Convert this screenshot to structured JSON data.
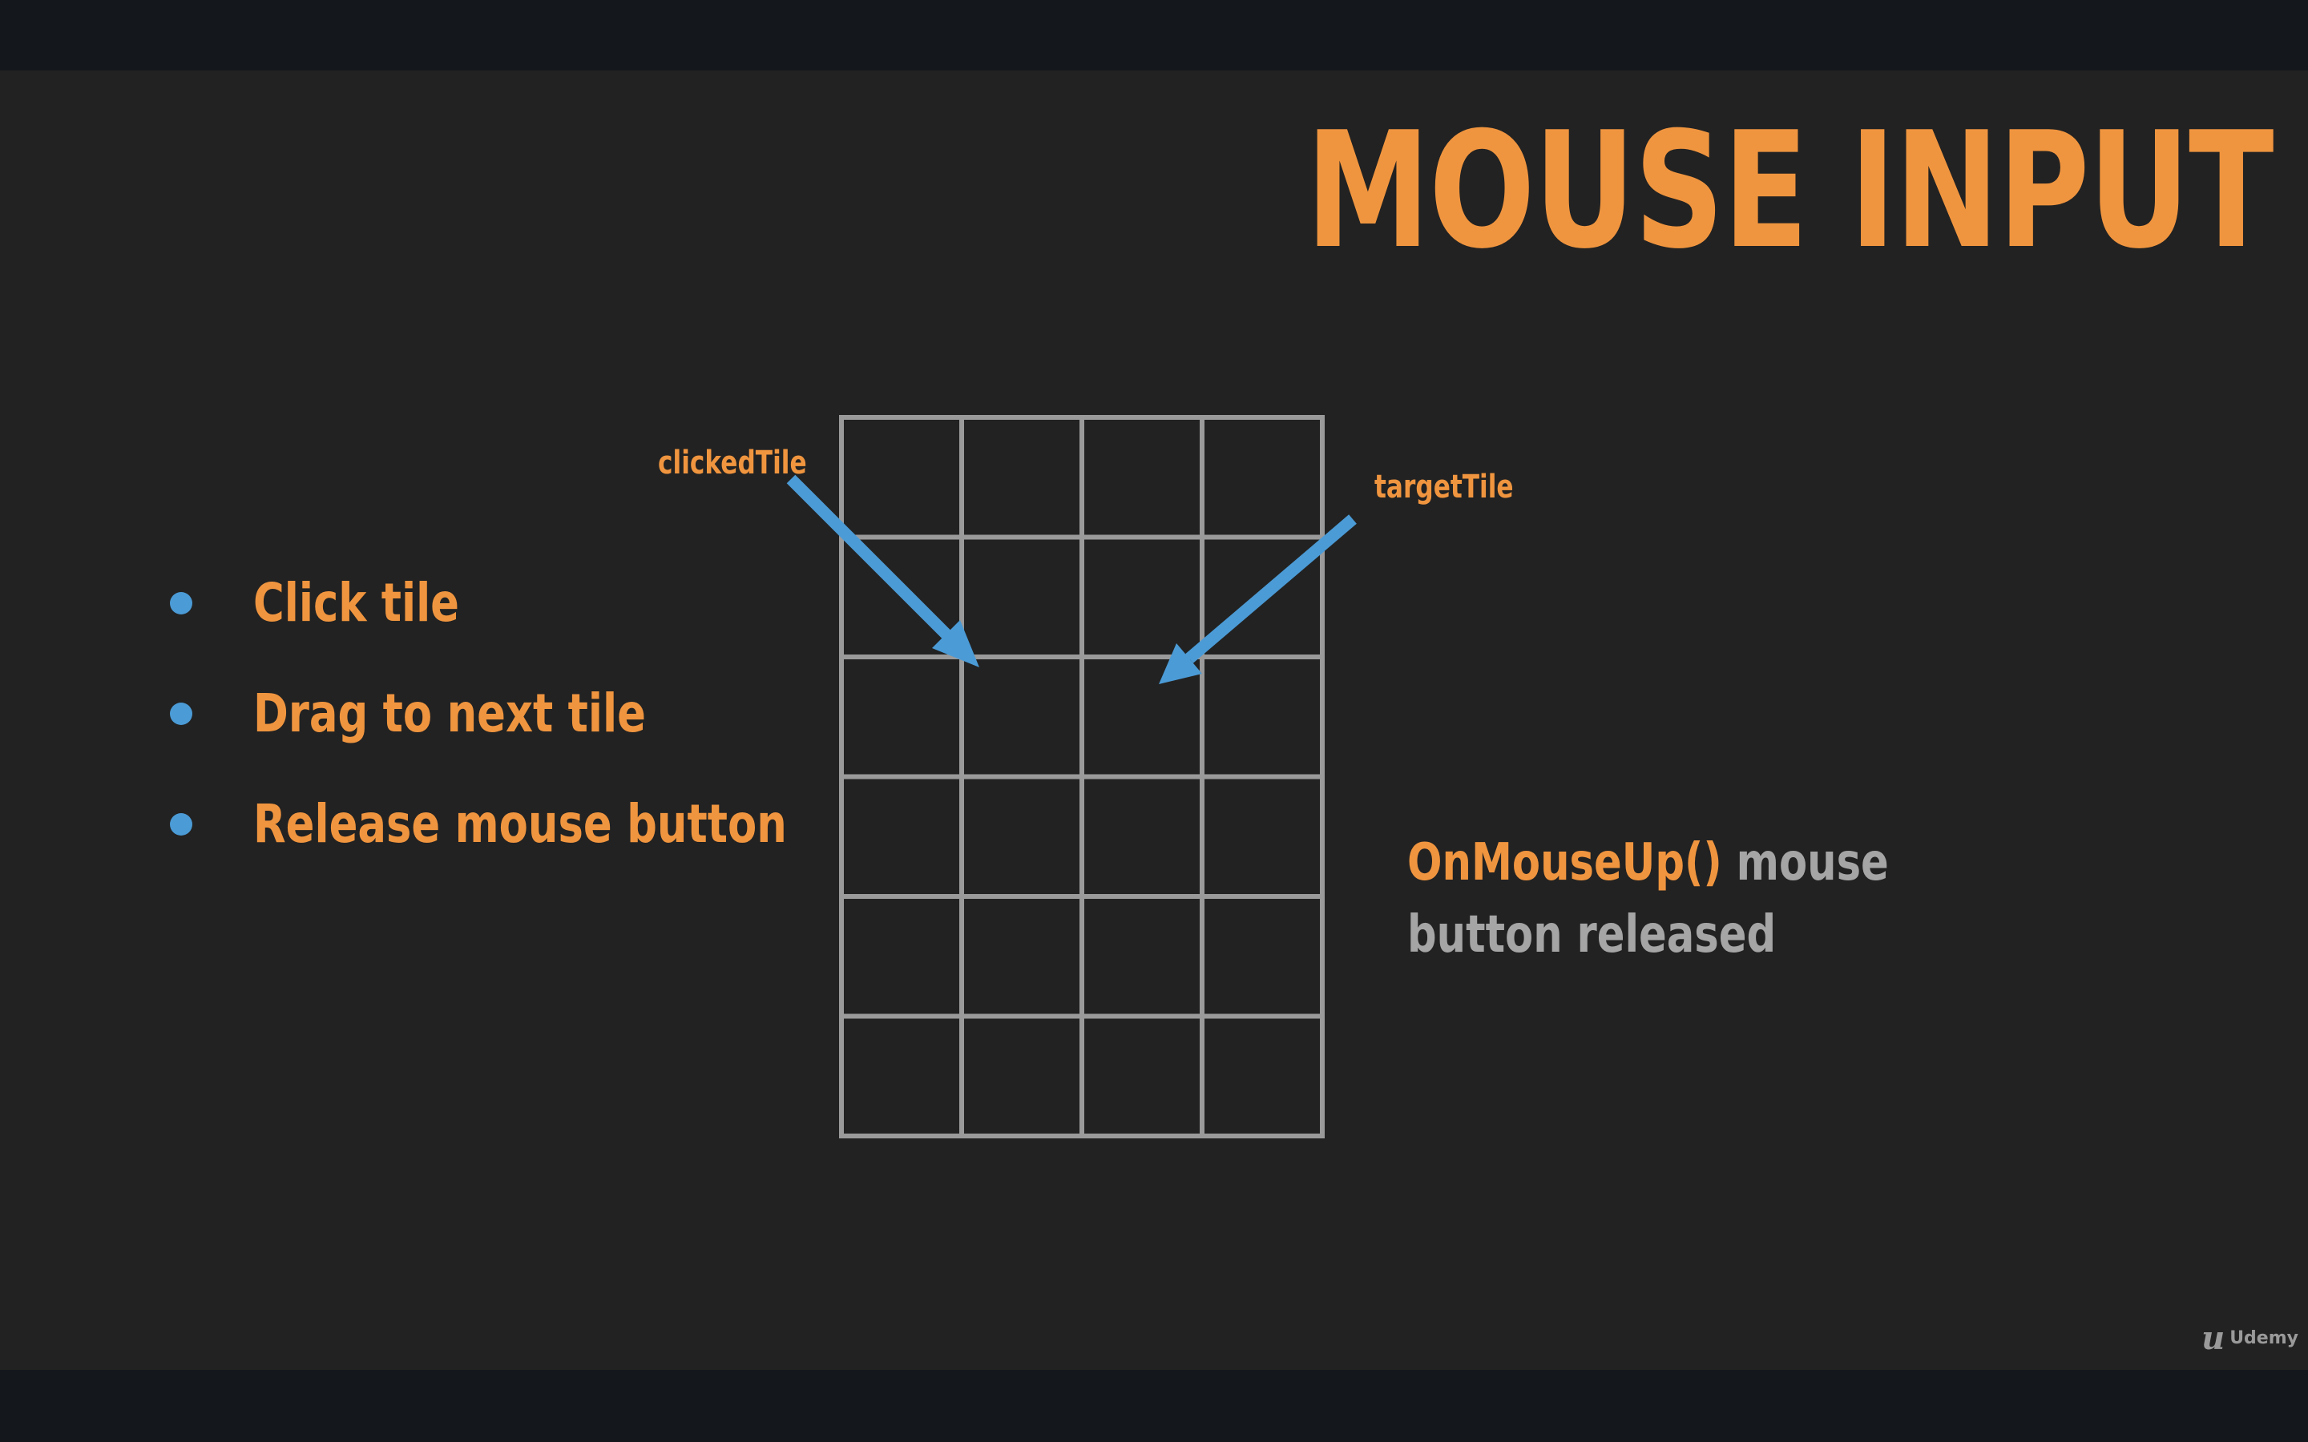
{
  "slide": {
    "title": "MOUSE INPUT",
    "bullets": [
      "Click tile",
      "Drag to next tile",
      "Release mouse button"
    ],
    "diagram": {
      "grid_columns": 4,
      "grid_rows": 6,
      "clicked_label": "clickedTile",
      "target_label": "targetTile"
    },
    "note": {
      "code": "OnMouseUp()",
      "text": " mouse button released"
    },
    "watermark": "Udemy"
  },
  "colors": {
    "accent": "#f0953f",
    "arrow": "#4b9bd6",
    "grid": "#9a9a9a",
    "background": "#222222",
    "frame": "#14171c",
    "note_text": "#a5a5a5"
  },
  "icons": {
    "bullet": "bullet-dot-icon",
    "arrow": "arrow-icon",
    "watermark": "udemy-logo-icon"
  }
}
